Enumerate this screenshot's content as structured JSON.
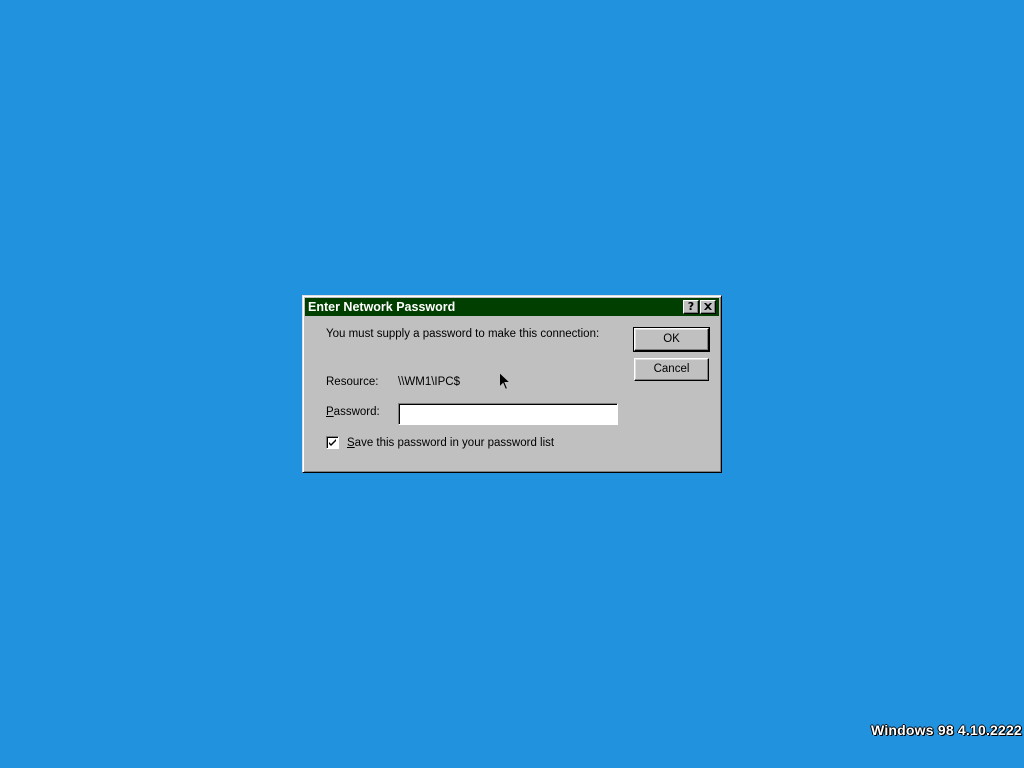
{
  "dialog": {
    "title": "Enter Network Password",
    "help_icon": "question-mark-icon",
    "close_icon": "close-icon",
    "message": "You must supply a password to make this connection:",
    "resource_label": "Resource:",
    "resource_value": "\\\\WM1\\IPC$",
    "password_label_first": "P",
    "password_label_rest": "assword:",
    "password_value": "",
    "save_checkbox_checked": true,
    "save_label_first": "S",
    "save_label_rest": "ave this password in your password list",
    "ok_label": "OK",
    "cancel_label": "Cancel"
  },
  "desktop": {
    "background_color": "#2192de",
    "version_text": "Windows 98 4.10.2222"
  },
  "colors": {
    "titlebar": "#003f00",
    "dialog_face": "#c0c0c0"
  }
}
